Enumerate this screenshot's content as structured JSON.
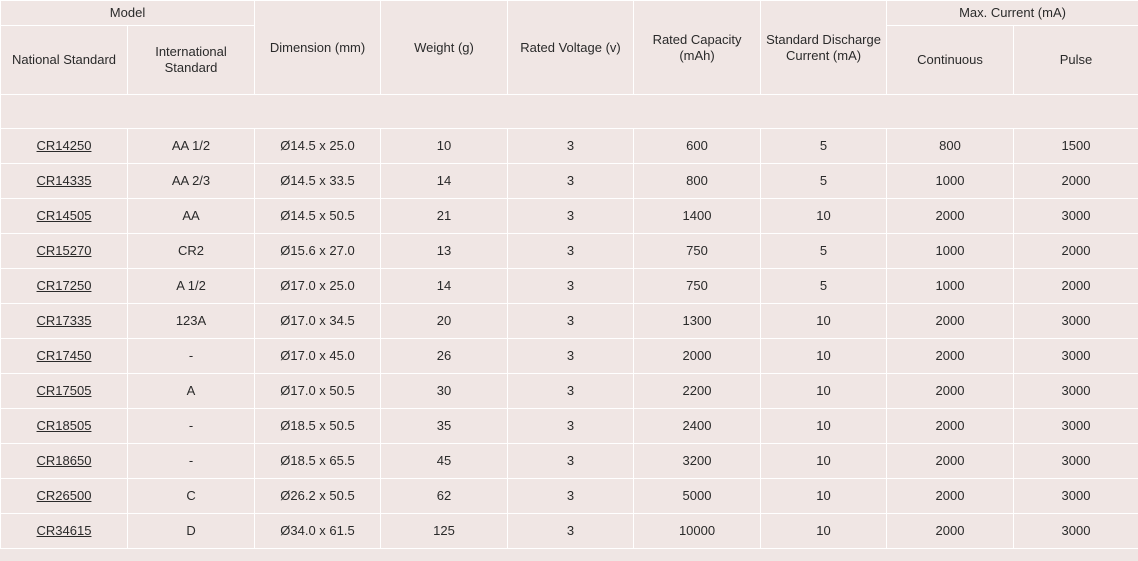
{
  "headers": {
    "model": "Model",
    "national": "National Standard",
    "international": "International Standard",
    "dimension": "Dimension (mm)",
    "weight": "Weight (g)",
    "voltage": "Rated Voltage (v)",
    "capacity": "Rated Capacity (mAh)",
    "discharge": "Standard Discharge Current (mA)",
    "max_current": "Max. Current (mA)",
    "continuous": "Continuous",
    "pulse": "Pulse"
  },
  "rows": [
    [
      "CR14250",
      "AA 1/2",
      "Ø14.5 x 25.0",
      "10",
      "3",
      "600",
      "5",
      "800",
      "1500"
    ],
    [
      "CR14335",
      "AA 2/3",
      "Ø14.5 x 33.5",
      "14",
      "3",
      "800",
      "5",
      "1000",
      "2000"
    ],
    [
      "CR14505",
      "AA",
      "Ø14.5 x 50.5",
      "21",
      "3",
      "1400",
      "10",
      "2000",
      "3000"
    ],
    [
      "CR15270",
      "CR2",
      "Ø15.6 x 27.0",
      "13",
      "3",
      "750",
      "5",
      "1000",
      "2000"
    ],
    [
      "CR17250",
      "A 1/2",
      "Ø17.0 x 25.0",
      "14",
      "3",
      "750",
      "5",
      "1000",
      "2000"
    ],
    [
      "CR17335",
      "123A",
      "Ø17.0 x 34.5",
      "20",
      "3",
      "1300",
      "10",
      "2000",
      "3000"
    ],
    [
      "CR17450",
      "-",
      "Ø17.0 x 45.0",
      "26",
      "3",
      "2000",
      "10",
      "2000",
      "3000"
    ],
    [
      "CR17505",
      "A",
      "Ø17.0 x 50.5",
      "30",
      "3",
      "2200",
      "10",
      "2000",
      "3000"
    ],
    [
      "CR18505",
      "-",
      "Ø18.5 x 50.5",
      "35",
      "3",
      "2400",
      "10",
      "2000",
      "3000"
    ],
    [
      "CR18650",
      "-",
      "Ø18.5 x 65.5",
      "45",
      "3",
      "3200",
      "10",
      "2000",
      "3000"
    ],
    [
      "CR26500",
      "C",
      "Ø26.2 x 50.5",
      "62",
      "3",
      "5000",
      "10",
      "2000",
      "3000"
    ],
    [
      "CR34615",
      "D",
      "Ø34.0 x 61.5",
      "125",
      "3",
      "10000",
      "10",
      "2000",
      "3000"
    ]
  ]
}
